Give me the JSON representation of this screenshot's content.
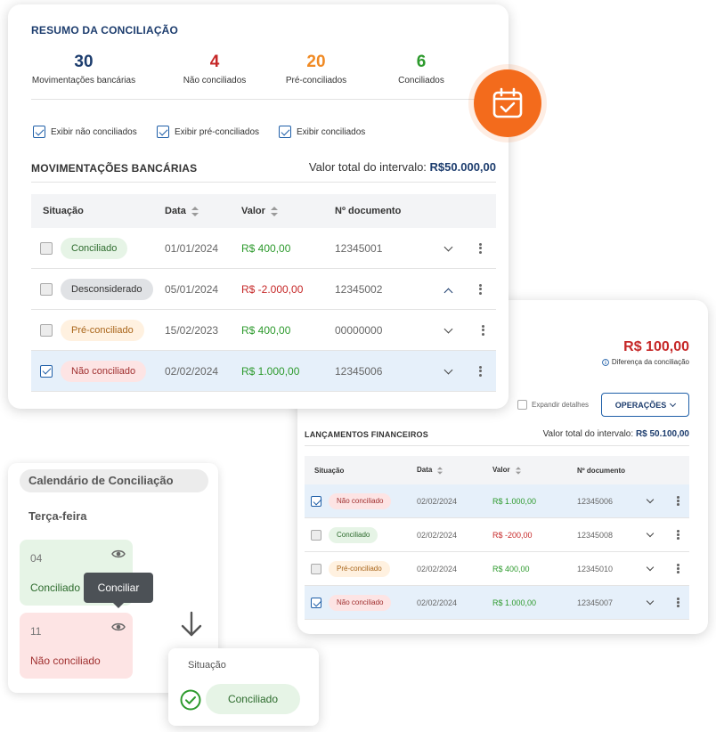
{
  "summary": {
    "title": "RESUMO DA CONCILIAÇÃO",
    "stats": [
      {
        "value": "30",
        "label": "Movimentações bancárias",
        "color": "#1d3d6e"
      },
      {
        "value": "4",
        "label": "Não conciliados",
        "color": "#c62828"
      },
      {
        "value": "20",
        "label": "Pré-conciliados",
        "color": "#f08a24"
      },
      {
        "value": "6",
        "label": "Conciliados",
        "color": "#2d9a2d"
      }
    ],
    "filters": [
      {
        "label": "Exibir não conciliados",
        "checked": true
      },
      {
        "label": "Exibir pré-conciliados",
        "checked": true
      },
      {
        "label": "Exibir conciliados",
        "checked": true
      }
    ]
  },
  "bank": {
    "title": "MOVIMENTAÇÕES BANCÁRIAS",
    "total_label": "Valor total do intervalo:",
    "total_value": "R$50.000,00",
    "headers": [
      "Situação",
      "Data",
      "Valor",
      "Nº documento"
    ],
    "rows": [
      {
        "status": "Conciliado",
        "date": "01/01/2024",
        "value": "R$ 400,00",
        "doc": "12345001"
      },
      {
        "status": "Desconsiderado",
        "date": "05/01/2024",
        "value": "R$ -2.000,00",
        "doc": "12345002"
      },
      {
        "status": "Pré-conciliado",
        "date": "15/02/2023",
        "value": "R$ 400,00",
        "doc": "00000000"
      },
      {
        "status": "Não conciliado",
        "date": "02/02/2024",
        "value": "R$ 1.000,00",
        "doc": "12345006"
      }
    ]
  },
  "financial": {
    "difference_value": "R$ 100,00",
    "difference_label": "Diferença da conciliação",
    "expand_label": "Expandir detalhes",
    "operations_label": "OPERAÇÕES",
    "title": "LANÇAMENTOS FINANCEIROS",
    "total_label": "Valor total do intervalo:",
    "total_value": "R$ 50.100,00",
    "headers": [
      "Situação",
      "Data",
      "Valor",
      "Nº documento"
    ],
    "rows": [
      {
        "status": "Não conciliado",
        "date": "02/02/2024",
        "value": "R$ 1.000,00",
        "doc": "12345006"
      },
      {
        "status": "Conciliado",
        "date": "02/02/2024",
        "value": "R$ -200,00",
        "doc": "12345008"
      },
      {
        "status": "Pré-conciliado",
        "date": "02/02/2024",
        "value": "R$ 400,00",
        "doc": "12345010"
      },
      {
        "status": "Não conciliado",
        "date": "02/02/2024",
        "value": "R$ 1.000,00",
        "doc": "12345007"
      }
    ]
  },
  "calendar": {
    "title": "Calendário de Conciliação",
    "day": "Terça-feira",
    "cells": [
      {
        "number": "04",
        "label": "Conciliado"
      },
      {
        "number": "11",
        "label": "Não conciliado"
      }
    ],
    "tooltip": "Conciliar"
  },
  "situacao": {
    "label": "Situação",
    "value": "Conciliado"
  },
  "colors": {
    "accent_orange": "#f36b1c",
    "navy": "#1d3d6e",
    "green": "#2d9a2d",
    "red": "#c62828"
  }
}
